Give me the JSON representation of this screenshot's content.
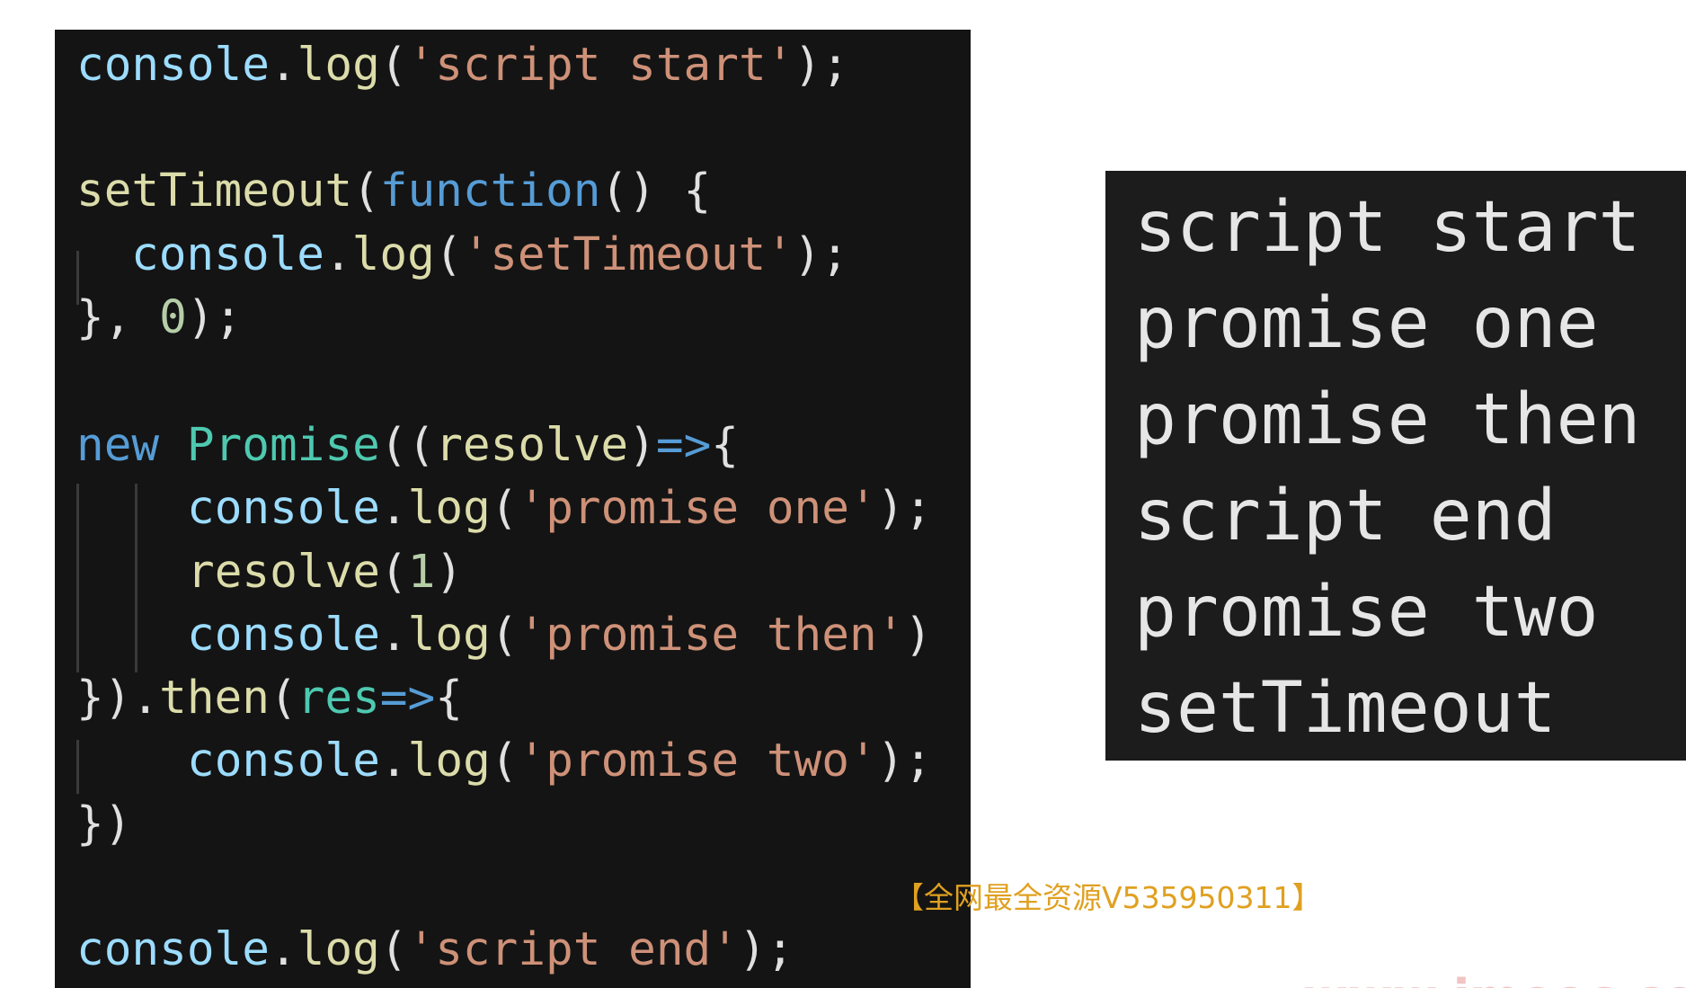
{
  "code": {
    "l1": {
      "a": "console",
      "b": ".",
      "c": "log",
      "d": "(",
      "e": "'script start'",
      "f": ");"
    },
    "l3": {
      "a": "setTimeout",
      "b": "(",
      "c": "function",
      "d": "() {"
    },
    "l4": {
      "a": "console",
      "b": ".",
      "c": "log",
      "d": "(",
      "e": "'setTimeout'",
      "f": ");"
    },
    "l5": {
      "a": "}, ",
      "b": "0",
      "c": ");"
    },
    "l7": {
      "a": "new",
      "b": " ",
      "c": "Promise",
      "d": "((",
      "e": "resolve",
      "f": ")",
      "g": "=>",
      "h": "{"
    },
    "l8": {
      "a": "console",
      "b": ".",
      "c": "log",
      "d": "(",
      "e": "'promise one'",
      "f": ");"
    },
    "l9": {
      "a": "resolve",
      "b": "(",
      "c": "1",
      "d": ")"
    },
    "l10": {
      "a": "console",
      "b": ".",
      "c": "log",
      "d": "(",
      "e": "'promise then'",
      "f": ")"
    },
    "l11": {
      "a": "}).",
      "b": "then",
      "c": "(",
      "d": "res",
      "e": "=>",
      "f": "{"
    },
    "l12": {
      "a": "console",
      "b": ".",
      "c": "log",
      "d": "(",
      "e": "'promise two'",
      "f": ");"
    },
    "l13": {
      "a": "})"
    },
    "l15": {
      "a": "console",
      "b": ".",
      "c": "log",
      "d": "(",
      "e": "'script end'",
      "f": ");"
    }
  },
  "output": {
    "lines": [
      "script start",
      "promise one",
      "promise then",
      "script end",
      "promise two",
      "setTimeout"
    ]
  },
  "watermark": "【全网最全资源V535950311】",
  "site_mark": "www.imooc.com",
  "colors": {
    "code_background": "#141414",
    "output_background": "#1c1c1c",
    "string": "#ce9178",
    "keyword": "#569cd6",
    "class": "#4ec9b0",
    "identifier": "#9cdcfe",
    "function_call": "#dcdcaa",
    "number": "#b5cea8",
    "watermark": "#e0a020"
  }
}
